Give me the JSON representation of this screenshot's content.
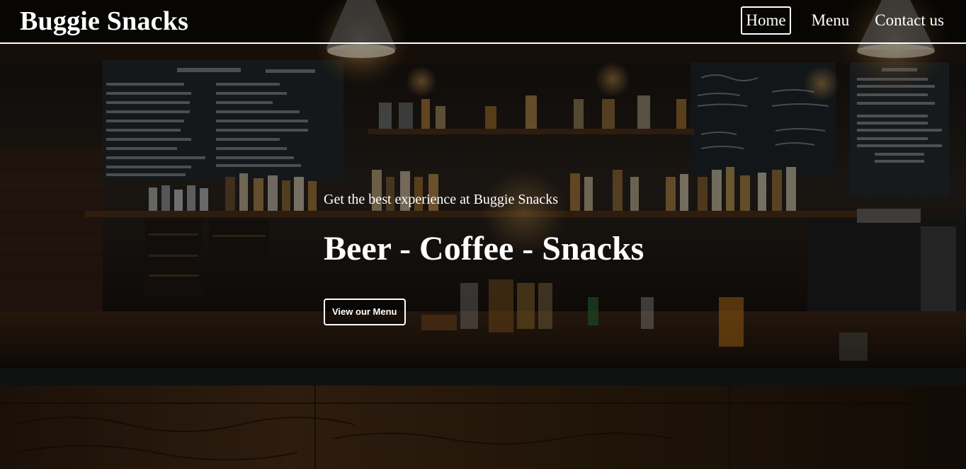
{
  "site": {
    "brand": "Buggie Snacks"
  },
  "nav": {
    "items": [
      {
        "label": "Home",
        "active": true
      },
      {
        "label": "Menu",
        "active": false
      },
      {
        "label": "Contact us",
        "active": false
      }
    ]
  },
  "hero": {
    "tagline": "Get the best experience at Buggie Snacks",
    "headline": "Beer - Coffee - Snacks",
    "cta_label": "View our Menu",
    "background_description_icon": "bar-interior-photo"
  },
  "theme": {
    "text_color": "#ffffff",
    "overlay_color": "#000000",
    "wood_color": "#5a3a20",
    "chalkboard_color": "#22272a"
  }
}
